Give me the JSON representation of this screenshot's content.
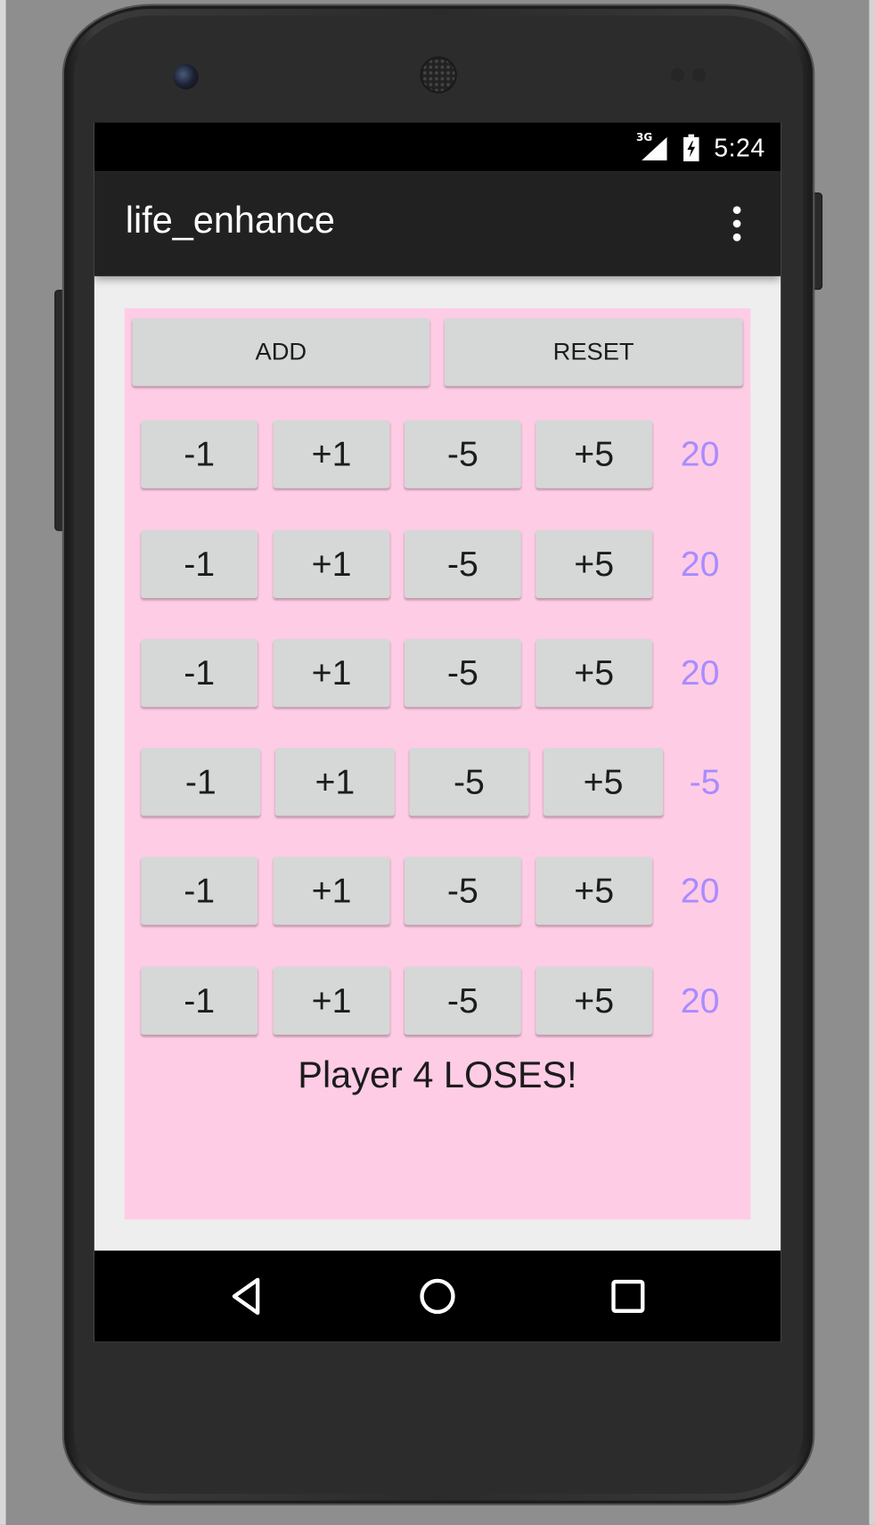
{
  "status_bar": {
    "network_label": "3G",
    "time": "5:24"
  },
  "action_bar": {
    "title": "life_enhance",
    "overflow_icon": "more-vert-icon"
  },
  "controls": {
    "add_label": "ADD",
    "reset_label": "RESET"
  },
  "players": [
    {
      "buttons": [
        "-1",
        "+1",
        "-5",
        "+5"
      ],
      "life": "20"
    },
    {
      "buttons": [
        "-1",
        "+1",
        "-5",
        "+5"
      ],
      "life": "20"
    },
    {
      "buttons": [
        "-1",
        "+1",
        "-5",
        "+5"
      ],
      "life": "20"
    },
    {
      "buttons": [
        "-1",
        "+1",
        "-5",
        "+5"
      ],
      "life": "-5"
    },
    {
      "buttons": [
        "-1",
        "+1",
        "-5",
        "+5"
      ],
      "life": "20"
    },
    {
      "buttons": [
        "-1",
        "+1",
        "-5",
        "+5"
      ],
      "life": "20"
    }
  ],
  "result_text": "Player 4 LOSES!",
  "nav_bar": {
    "back_icon": "back-triangle-icon",
    "home_icon": "home-circle-icon",
    "recents_icon": "recents-square-icon"
  },
  "colors": {
    "content_background": "#ffcce6",
    "life_text": "#a98bff",
    "button_background": "#d6d7d7",
    "action_bar": "#212121"
  }
}
